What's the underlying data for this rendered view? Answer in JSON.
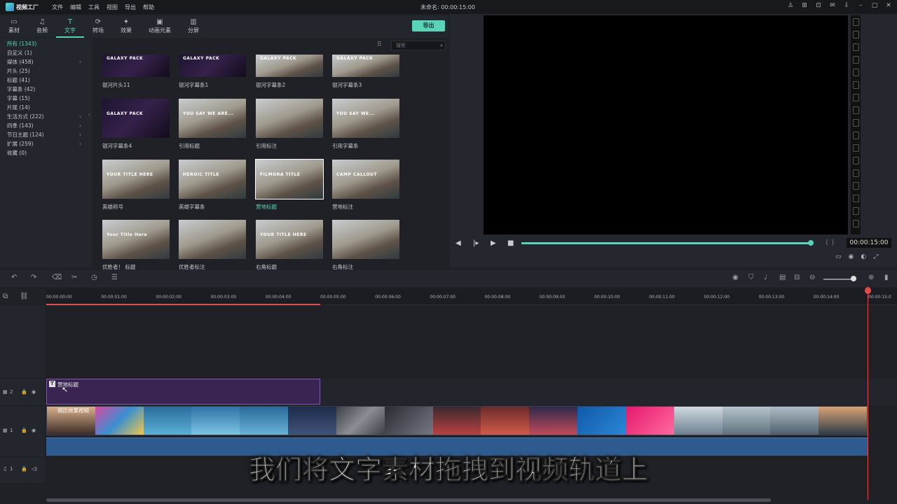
{
  "app": {
    "logo_text": "视频工厂",
    "window_title": "未命名: 00:00:15:00"
  },
  "menu": [
    "文件",
    "编辑",
    "工具",
    "视图",
    "导出",
    "帮助"
  ],
  "tabs": [
    {
      "icon": "▭",
      "label": "素材"
    },
    {
      "icon": "♫",
      "label": "音频"
    },
    {
      "icon": "T",
      "label": "文字"
    },
    {
      "icon": "⟳",
      "label": "转场"
    },
    {
      "icon": "✦",
      "label": "效果"
    },
    {
      "icon": "▣",
      "label": "动画元素"
    },
    {
      "icon": "▥",
      "label": "分屏"
    }
  ],
  "export_label": "导出",
  "search": {
    "placeholder": "搜索"
  },
  "categories": [
    {
      "label": "所有 (1343)",
      "has_arrow": false
    },
    {
      "label": "自定义 (1)",
      "has_arrow": false
    },
    {
      "label": "媒体 (458)",
      "has_arrow": true
    },
    {
      "label": "片头 (25)",
      "has_arrow": false
    },
    {
      "label": "标题 (41)",
      "has_arrow": false
    },
    {
      "label": "字幕条 (42)",
      "has_arrow": false
    },
    {
      "label": "字幕 (15)",
      "has_arrow": false
    },
    {
      "label": "片尾 (14)",
      "has_arrow": false
    },
    {
      "label": "生活方式 (222)",
      "has_arrow": true
    },
    {
      "label": "四季 (143)",
      "has_arrow": true
    },
    {
      "label": "节日主题 (124)",
      "has_arrow": true
    },
    {
      "label": "扩展 (259)",
      "has_arrow": true
    },
    {
      "label": "收藏 (0)",
      "has_arrow": false
    }
  ],
  "thumbs": [
    {
      "label": "银河片头11",
      "text": "GALAXY PACK"
    },
    {
      "label": "银河字幕条1",
      "text": "GALAXY PACK"
    },
    {
      "label": "银河字幕条2",
      "text": "GALAXY PACK"
    },
    {
      "label": "银河字幕条3",
      "text": "GALAXY PACK"
    },
    {
      "label": "银河字幕条4",
      "text": "GALAXY PACK"
    },
    {
      "label": "引用标题",
      "text": "YOU SAY WE ARE..."
    },
    {
      "label": "引用标注",
      "text": ""
    },
    {
      "label": "引用字幕条",
      "text": "YOU SAY WE..."
    },
    {
      "label": "英雄称号",
      "text": "YOUR TITLE HERE"
    },
    {
      "label": "英雄字幕条",
      "text": "HEROIC TITLE"
    },
    {
      "label": "营地标题",
      "text": "FILMORA TITLE"
    },
    {
      "label": "营地标注",
      "text": "CAMP CALLOUT"
    },
    {
      "label": "优胜者！ 标题",
      "text": "Your Title Here"
    },
    {
      "label": "优胜者标注",
      "text": ""
    },
    {
      "label": "右角标题",
      "text": "YOUR TITLE HERE"
    },
    {
      "label": "右角标注",
      "text": ""
    }
  ],
  "preview": {
    "timecode": "00:00:15:00",
    "progress": 0.99
  },
  "ruler": [
    "00:00:00:00",
    "00:00:01:00",
    "00:00:02:00",
    "00:00:03:00",
    "00:00:04:00",
    "00:00:05:00",
    "00:00:06:00",
    "00:00:07:00",
    "00:00:08:00",
    "00:00:09:00",
    "00:00:10:00",
    "00:00:11:00",
    "00:00:12:00",
    "00:00:13:00",
    "00:00:14:00",
    "00:00:15:0"
  ],
  "tracks": {
    "t2": "2",
    "t1": "1",
    "a1": "1"
  },
  "clips": {
    "title_clip": "营地标题",
    "video_clip": "简历效果视频"
  },
  "subtitle": "我们将文字素材拖拽到视频轨道上"
}
